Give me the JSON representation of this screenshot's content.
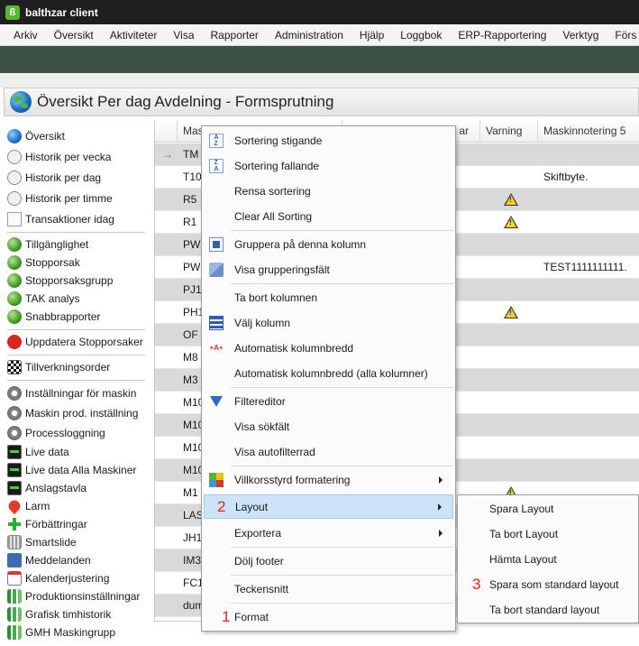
{
  "app": {
    "logo": "ß",
    "title": "balthzar client"
  },
  "menubar": [
    "Arkiv",
    "Översikt",
    "Aktiviteter",
    "Visa",
    "Rapporter",
    "Administration",
    "Hjälp",
    "Loggbok",
    "ERP-Rapportering",
    "Verktyg",
    "Förs"
  ],
  "page": {
    "title": "Översikt Per dag Avdelning - Formsprutning"
  },
  "sidebar": {
    "items": [
      {
        "label": "Översikt",
        "icon": "globe-icon"
      },
      {
        "label": "Historik per vecka",
        "icon": "clock-icon"
      },
      {
        "label": "Historik per dag",
        "icon": "clock-icon"
      },
      {
        "label": "Historik per timme",
        "icon": "clock-icon"
      },
      {
        "label": "Transaktioner idag",
        "icon": "document-icon"
      },
      {
        "label": "Tillgänglighet",
        "icon": "green-globe-icon"
      },
      {
        "label": "Stopporsak",
        "icon": "green-globe-icon"
      },
      {
        "label": "Stopporsaksgrupp",
        "icon": "green-globe-icon"
      },
      {
        "label": "TAK analys",
        "icon": "green-globe-icon"
      },
      {
        "label": "Snabbrapporter",
        "icon": "green-globe-icon"
      },
      {
        "label": "Uppdatera Stopporsaker",
        "icon": "stop-sign-icon"
      },
      {
        "label": "Tillverkningsorder",
        "icon": "checkered-flag-icon"
      },
      {
        "label": "Inställningar för maskin",
        "icon": "gear-icon"
      },
      {
        "label": "Maskin prod. inställning",
        "icon": "gear-icon"
      },
      {
        "label": "Processloggning",
        "icon": "gear-icon"
      },
      {
        "label": "Live data",
        "icon": "monitor-icon"
      },
      {
        "label": "Live data Alla Maskiner",
        "icon": "monitor-icon"
      },
      {
        "label": "Anslagstavla",
        "icon": "monitor-icon"
      },
      {
        "label": "Larm",
        "icon": "map-pin-icon"
      },
      {
        "label": "Förbättringar",
        "icon": "plus-icon"
      },
      {
        "label": "Smartslide",
        "icon": "grid-icon"
      },
      {
        "label": "Meddelanden",
        "icon": "envelope-icon"
      },
      {
        "label": "Kalenderjustering",
        "icon": "calendar-icon"
      },
      {
        "label": "Produktionsinställningar",
        "icon": "bar-chart-icon"
      },
      {
        "label": "Grafisk timhistorik",
        "icon": "bar-chart-icon"
      },
      {
        "label": "GMH Maskingrupp",
        "icon": "bar-chart-icon"
      }
    ]
  },
  "grid": {
    "columns": [
      "Mas",
      "ar",
      "Varning",
      "Maskinnotering 5"
    ],
    "current_row_indicator": "→",
    "rows": [
      {
        "c0": "TM",
        "warning": false,
        "note": "",
        "group": true,
        "current": true
      },
      {
        "c0": "T10",
        "warning": false,
        "note": "Skiftbyte.",
        "group": false
      },
      {
        "c0": "R5",
        "warning": true,
        "note": "",
        "group": true
      },
      {
        "c0": "R1",
        "warning": true,
        "note": "",
        "group": false
      },
      {
        "c0": "PW2",
        "warning": false,
        "note": "",
        "group": true
      },
      {
        "c0": "PW1",
        "warning": false,
        "note": "TEST1111111111.",
        "group": false
      },
      {
        "c0": "PJ1",
        "warning": false,
        "note": "",
        "group": true
      },
      {
        "c0": "PH1",
        "warning": true,
        "note": "",
        "group": false
      },
      {
        "c0": "OF",
        "warning": false,
        "note": "",
        "group": true
      },
      {
        "c0": "M8",
        "warning": false,
        "note": "",
        "group": false
      },
      {
        "c0": "M3",
        "warning": false,
        "note": "",
        "group": true
      },
      {
        "c0": "M10",
        "warning": false,
        "note": "",
        "group": false
      },
      {
        "c0": "M10",
        "warning": false,
        "note": "",
        "group": true
      },
      {
        "c0": "M10",
        "warning": false,
        "note": "",
        "group": false
      },
      {
        "c0": "M10",
        "warning": false,
        "note": "",
        "group": true
      },
      {
        "c0": "M1",
        "warning": true,
        "note": "",
        "group": false
      },
      {
        "c0": "LAS",
        "warning": false,
        "note": "",
        "group": true
      },
      {
        "c0": "JH1",
        "warning": false,
        "note": "",
        "group": false
      },
      {
        "c0": "IM3",
        "warning": false,
        "note": "",
        "group": true
      },
      {
        "c0": "FC1",
        "warning": false,
        "note": "",
        "group": false
      },
      {
        "c0": "dum",
        "warning": false,
        "note": "",
        "group": true
      }
    ]
  },
  "context_menu": {
    "items": [
      {
        "label": "Sortering stigande",
        "icon": "sort-ascending-icon"
      },
      {
        "label": "Sortering fallande",
        "icon": "sort-descending-icon"
      },
      {
        "label": "Rensa sortering",
        "icon": ""
      },
      {
        "label": "Clear All Sorting",
        "icon": ""
      },
      {
        "label": "Gruppera på denna kolumn",
        "icon": "group-by-column-icon"
      },
      {
        "label": "Visa grupperingsfält",
        "icon": "group-panel-icon"
      },
      {
        "label": "Ta bort kolumnen",
        "icon": ""
      },
      {
        "label": "Välj kolumn",
        "icon": "column-chooser-icon"
      },
      {
        "label": "Automatisk kolumnbredd",
        "icon": "best-fit-icon"
      },
      {
        "label": "Automatisk kolumnbredd (alla kolumner)",
        "icon": ""
      },
      {
        "label": "Filtereditor",
        "icon": "filter-icon"
      },
      {
        "label": "Visa sökfält",
        "icon": ""
      },
      {
        "label": "Visa autofilterrad",
        "icon": ""
      },
      {
        "label": "Villkorsstyrd formatering",
        "icon": "conditional-formatting-icon",
        "submenu": true
      },
      {
        "label": "Layout",
        "icon": "",
        "submenu": true,
        "highlighted": true,
        "badge": "2"
      },
      {
        "label": "Exportera",
        "icon": "",
        "submenu": true
      },
      {
        "label": "Dölj footer",
        "icon": ""
      },
      {
        "label": "Teckensnitt",
        "icon": ""
      },
      {
        "label": "Format",
        "icon": "",
        "badge": "1"
      }
    ]
  },
  "layout_submenu": {
    "items": [
      {
        "label": "Spara Layout"
      },
      {
        "label": "Ta bort Layout"
      },
      {
        "label": "Hämta Layout"
      },
      {
        "label": "Spara som standard layout",
        "badge": "3"
      },
      {
        "label": "Ta bort standard layout"
      }
    ]
  },
  "colors": {
    "green_band": "#3d5244",
    "highlight": "#cce4f7",
    "badge": "#e0251b",
    "group_row": "#d9d9d9"
  }
}
